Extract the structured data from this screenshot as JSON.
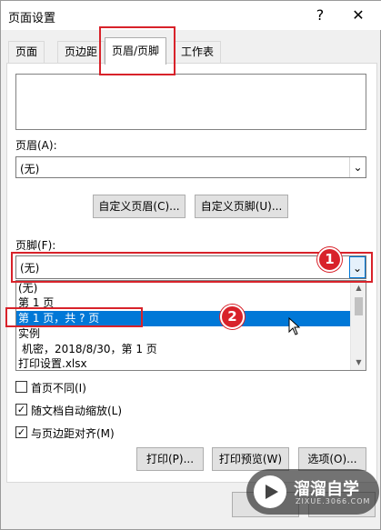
{
  "window": {
    "title": "页面设置",
    "help_label": "?",
    "close_label": "✕"
  },
  "tabs": [
    {
      "label": "页面"
    },
    {
      "label": "页边距"
    },
    {
      "label": "页眉/页脚"
    },
    {
      "label": "工作表"
    }
  ],
  "header": {
    "label": "页眉(A):",
    "value": "(无)"
  },
  "buttons": {
    "custom_header": "自定义页眉(C)...",
    "custom_footer": "自定义页脚(U)...",
    "print": "打印(P)...",
    "print_preview": "打印预览(W)",
    "options": "选项(O)..."
  },
  "footer": {
    "label": "页脚(F):",
    "value": "(无)",
    "options": [
      "(无)",
      "第 1 页",
      "第 1 页，共 ? 页",
      "实例",
      " 机密，2018/8/30，第 1 页",
      "打印设置.xlsx"
    ],
    "selected_index": 2
  },
  "checkboxes": [
    {
      "label": "首页不同(I)",
      "checked": false
    },
    {
      "label": "随文档自动缩放(L)",
      "checked": true
    },
    {
      "label": "与页边距对齐(M)",
      "checked": true
    }
  ],
  "annotations": {
    "marker_1": "1",
    "marker_2": "2",
    "accent_color": "#d8222a"
  },
  "watermark": {
    "brand": "溜溜自学",
    "url": "ZIXUE.3066.COM"
  }
}
